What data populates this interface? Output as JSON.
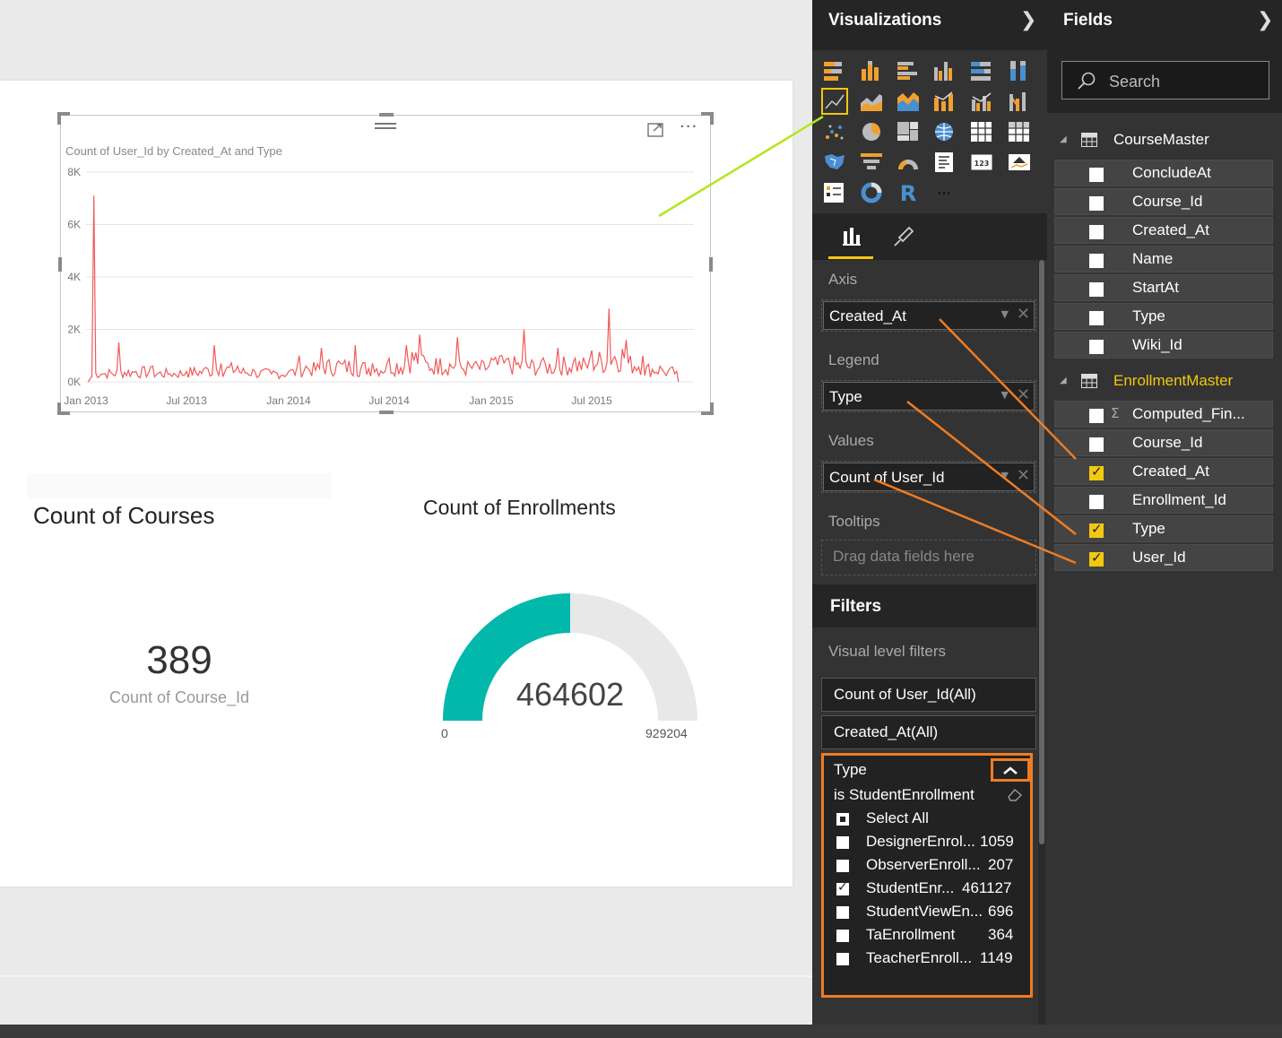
{
  "canvas": {
    "line_chart": {
      "title": "Count of User_Id by Created_At and Type",
      "more_options": "···",
      "y_ticks": [
        "8K",
        "6K",
        "4K",
        "2K",
        "0K"
      ],
      "x_ticks": [
        "Jan 2013",
        "Jul 2013",
        "Jan 2014",
        "Jul 2014",
        "Jan 2015",
        "Jul 2015"
      ]
    },
    "card_courses": {
      "title": "Count of Courses",
      "value": "389",
      "label": "Count of Course_Id"
    },
    "gauge_enrollments": {
      "title": "Count of Enrollments",
      "value": "464602",
      "min": "0",
      "max": "929204"
    }
  },
  "chart_data": [
    {
      "type": "line",
      "title": "Count of User_Id by Created_At and Type",
      "xlabel": "",
      "ylabel": "",
      "ylim": [
        0,
        8000
      ],
      "x_ticks": [
        "Jan 2013",
        "Jul 2013",
        "Jan 2014",
        "Jul 2014",
        "Jan 2015",
        "Jul 2015"
      ],
      "color": "#f05a5a",
      "series": [
        {
          "x": [
            "2013-01-08",
            "2013-01-15",
            "2013-02-01",
            "2013-03-01",
            "2013-04-01",
            "2013-05-01",
            "2013-06-01",
            "2013-07-01",
            "2013-08-01",
            "2013-08-20",
            "2013-09-01",
            "2013-10-01",
            "2013-11-01",
            "2013-12-01",
            "2014-01-01",
            "2014-01-20",
            "2014-02-01",
            "2014-03-01",
            "2014-04-01",
            "2014-05-01",
            "2014-06-01",
            "2014-07-01",
            "2014-08-01",
            "2014-08-25",
            "2014-09-01",
            "2014-10-01",
            "2014-11-01",
            "2014-12-01",
            "2015-01-01",
            "2015-01-20",
            "2015-02-01",
            "2015-03-01",
            "2015-04-01",
            "2015-05-01",
            "2015-06-01",
            "2015-07-01",
            "2015-08-01",
            "2015-09-01",
            "2015-10-01",
            "2015-11-01",
            "2015-12-01"
          ],
          "y": [
            100,
            7100,
            300,
            1500,
            400,
            600,
            300,
            400,
            500,
            1400,
            700,
            600,
            400,
            300,
            400,
            1000,
            600,
            1300,
            800,
            1400,
            700,
            900,
            1400,
            1800,
            1000,
            900,
            1700,
            700,
            900,
            1000,
            900,
            2000,
            800,
            1300,
            900,
            1200,
            2800,
            1600,
            1000,
            600,
            400
          ]
        }
      ]
    },
    {
      "type": "gauge",
      "title": "Count of Enrollments",
      "value": 464602,
      "min": 0,
      "max": 929204,
      "fill_color": "#01b8aa",
      "track_color": "#e8e8e8"
    }
  ],
  "visualizations": {
    "title": "Visualizations",
    "tabs": [
      "fields-tab",
      "format-tab"
    ],
    "axis_label": "Axis",
    "axis_field": "Created_At",
    "legend_label": "Legend",
    "legend_field": "Type",
    "values_label": "Values",
    "values_field": "Count of User_Id",
    "tooltips_label": "Tooltips",
    "tooltips_placeholder": "Drag data fields here",
    "more_visuals": "···"
  },
  "filters": {
    "title": "Filters",
    "visual_level": "Visual level filters",
    "items": [
      "Count of User_Id(All)",
      "Created_At(All)"
    ],
    "type_filter": {
      "field": "Type",
      "condition": "is StudentEnrollment",
      "select_all": "Select All",
      "options": [
        {
          "label": "DesignerEnrol...",
          "count": "1059",
          "checked": false
        },
        {
          "label": "ObserverEnroll...",
          "count": "207",
          "checked": false
        },
        {
          "label": "StudentEnr...",
          "count": "461127",
          "checked": true
        },
        {
          "label": "StudentViewEn...",
          "count": "696",
          "checked": false
        },
        {
          "label": "TaEnrollment",
          "count": "364",
          "checked": false
        },
        {
          "label": "TeacherEnroll...",
          "count": "1149",
          "checked": false
        }
      ]
    }
  },
  "fields": {
    "title": "Fields",
    "search_placeholder": "Search",
    "tables": [
      {
        "name": "CourseMaster",
        "highlighted": false,
        "fields": [
          {
            "label": "ConcludeAt",
            "checked": false
          },
          {
            "label": "Course_Id",
            "checked": false
          },
          {
            "label": "Created_At",
            "checked": false
          },
          {
            "label": "Name",
            "checked": false
          },
          {
            "label": "StartAt",
            "checked": false
          },
          {
            "label": "Type",
            "checked": false
          },
          {
            "label": "Wiki_Id",
            "checked": false
          }
        ]
      },
      {
        "name": "EnrollmentMaster",
        "highlighted": true,
        "fields": [
          {
            "label": "Computed_Fin...",
            "checked": false,
            "sigma": true
          },
          {
            "label": "Course_Id",
            "checked": false
          },
          {
            "label": "Created_At",
            "checked": true
          },
          {
            "label": "Enrollment_Id",
            "checked": false
          },
          {
            "label": "Type",
            "checked": true
          },
          {
            "label": "User_Id",
            "checked": true
          }
        ]
      }
    ]
  },
  "colors": {
    "accent_yellow": "#f2c811",
    "annotation_orange": "#ef7c22",
    "annotation_green": "#b5e61d",
    "line_red": "#f05a5a",
    "gauge_teal": "#01b8aa"
  }
}
